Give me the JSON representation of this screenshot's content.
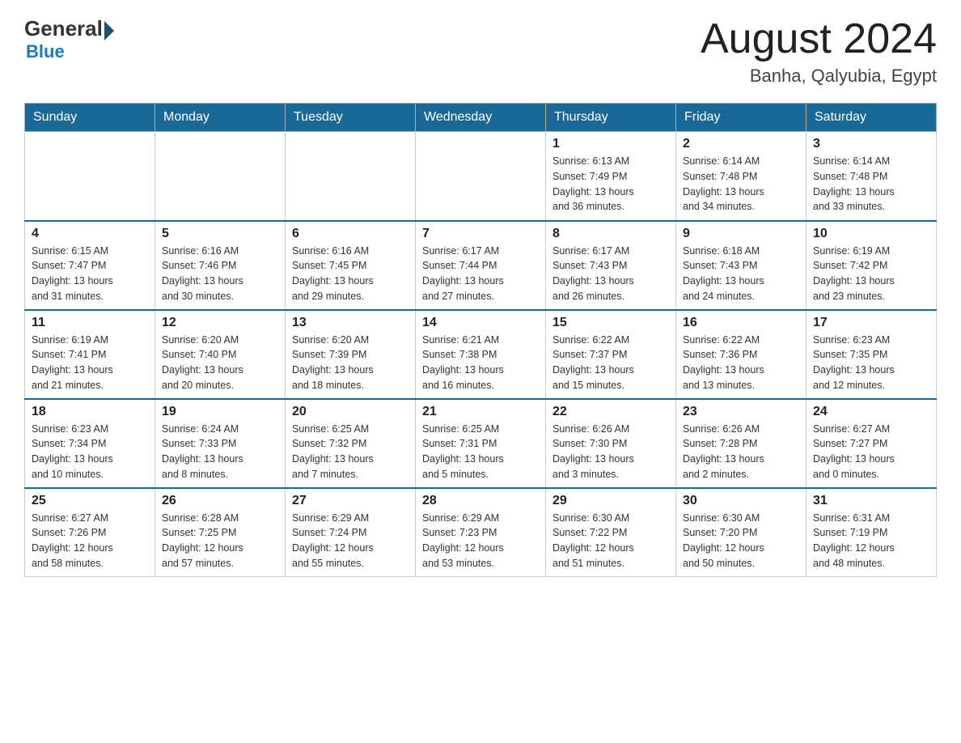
{
  "header": {
    "logo_general": "General",
    "logo_blue": "Blue",
    "month_title": "August 2024",
    "location": "Banha, Qalyubia, Egypt"
  },
  "days_of_week": [
    "Sunday",
    "Monday",
    "Tuesday",
    "Wednesday",
    "Thursday",
    "Friday",
    "Saturday"
  ],
  "weeks": [
    [
      {
        "day": "",
        "info": ""
      },
      {
        "day": "",
        "info": ""
      },
      {
        "day": "",
        "info": ""
      },
      {
        "day": "",
        "info": ""
      },
      {
        "day": "1",
        "info": "Sunrise: 6:13 AM\nSunset: 7:49 PM\nDaylight: 13 hours\nand 36 minutes."
      },
      {
        "day": "2",
        "info": "Sunrise: 6:14 AM\nSunset: 7:48 PM\nDaylight: 13 hours\nand 34 minutes."
      },
      {
        "day": "3",
        "info": "Sunrise: 6:14 AM\nSunset: 7:48 PM\nDaylight: 13 hours\nand 33 minutes."
      }
    ],
    [
      {
        "day": "4",
        "info": "Sunrise: 6:15 AM\nSunset: 7:47 PM\nDaylight: 13 hours\nand 31 minutes."
      },
      {
        "day": "5",
        "info": "Sunrise: 6:16 AM\nSunset: 7:46 PM\nDaylight: 13 hours\nand 30 minutes."
      },
      {
        "day": "6",
        "info": "Sunrise: 6:16 AM\nSunset: 7:45 PM\nDaylight: 13 hours\nand 29 minutes."
      },
      {
        "day": "7",
        "info": "Sunrise: 6:17 AM\nSunset: 7:44 PM\nDaylight: 13 hours\nand 27 minutes."
      },
      {
        "day": "8",
        "info": "Sunrise: 6:17 AM\nSunset: 7:43 PM\nDaylight: 13 hours\nand 26 minutes."
      },
      {
        "day": "9",
        "info": "Sunrise: 6:18 AM\nSunset: 7:43 PM\nDaylight: 13 hours\nand 24 minutes."
      },
      {
        "day": "10",
        "info": "Sunrise: 6:19 AM\nSunset: 7:42 PM\nDaylight: 13 hours\nand 23 minutes."
      }
    ],
    [
      {
        "day": "11",
        "info": "Sunrise: 6:19 AM\nSunset: 7:41 PM\nDaylight: 13 hours\nand 21 minutes."
      },
      {
        "day": "12",
        "info": "Sunrise: 6:20 AM\nSunset: 7:40 PM\nDaylight: 13 hours\nand 20 minutes."
      },
      {
        "day": "13",
        "info": "Sunrise: 6:20 AM\nSunset: 7:39 PM\nDaylight: 13 hours\nand 18 minutes."
      },
      {
        "day": "14",
        "info": "Sunrise: 6:21 AM\nSunset: 7:38 PM\nDaylight: 13 hours\nand 16 minutes."
      },
      {
        "day": "15",
        "info": "Sunrise: 6:22 AM\nSunset: 7:37 PM\nDaylight: 13 hours\nand 15 minutes."
      },
      {
        "day": "16",
        "info": "Sunrise: 6:22 AM\nSunset: 7:36 PM\nDaylight: 13 hours\nand 13 minutes."
      },
      {
        "day": "17",
        "info": "Sunrise: 6:23 AM\nSunset: 7:35 PM\nDaylight: 13 hours\nand 12 minutes."
      }
    ],
    [
      {
        "day": "18",
        "info": "Sunrise: 6:23 AM\nSunset: 7:34 PM\nDaylight: 13 hours\nand 10 minutes."
      },
      {
        "day": "19",
        "info": "Sunrise: 6:24 AM\nSunset: 7:33 PM\nDaylight: 13 hours\nand 8 minutes."
      },
      {
        "day": "20",
        "info": "Sunrise: 6:25 AM\nSunset: 7:32 PM\nDaylight: 13 hours\nand 7 minutes."
      },
      {
        "day": "21",
        "info": "Sunrise: 6:25 AM\nSunset: 7:31 PM\nDaylight: 13 hours\nand 5 minutes."
      },
      {
        "day": "22",
        "info": "Sunrise: 6:26 AM\nSunset: 7:30 PM\nDaylight: 13 hours\nand 3 minutes."
      },
      {
        "day": "23",
        "info": "Sunrise: 6:26 AM\nSunset: 7:28 PM\nDaylight: 13 hours\nand 2 minutes."
      },
      {
        "day": "24",
        "info": "Sunrise: 6:27 AM\nSunset: 7:27 PM\nDaylight: 13 hours\nand 0 minutes."
      }
    ],
    [
      {
        "day": "25",
        "info": "Sunrise: 6:27 AM\nSunset: 7:26 PM\nDaylight: 12 hours\nand 58 minutes."
      },
      {
        "day": "26",
        "info": "Sunrise: 6:28 AM\nSunset: 7:25 PM\nDaylight: 12 hours\nand 57 minutes."
      },
      {
        "day": "27",
        "info": "Sunrise: 6:29 AM\nSunset: 7:24 PM\nDaylight: 12 hours\nand 55 minutes."
      },
      {
        "day": "28",
        "info": "Sunrise: 6:29 AM\nSunset: 7:23 PM\nDaylight: 12 hours\nand 53 minutes."
      },
      {
        "day": "29",
        "info": "Sunrise: 6:30 AM\nSunset: 7:22 PM\nDaylight: 12 hours\nand 51 minutes."
      },
      {
        "day": "30",
        "info": "Sunrise: 6:30 AM\nSunset: 7:20 PM\nDaylight: 12 hours\nand 50 minutes."
      },
      {
        "day": "31",
        "info": "Sunrise: 6:31 AM\nSunset: 7:19 PM\nDaylight: 12 hours\nand 48 minutes."
      }
    ]
  ]
}
